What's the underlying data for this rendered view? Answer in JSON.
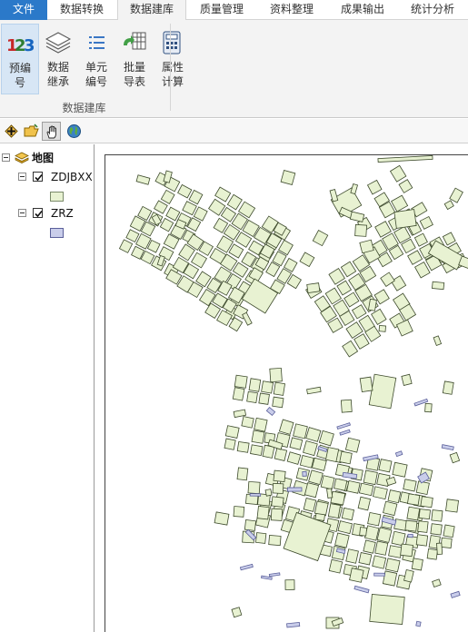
{
  "tabs": [
    {
      "label": "文件",
      "name": "tab-file"
    },
    {
      "label": "数据转换",
      "name": "tab-data-conversion"
    },
    {
      "label": "数据建库",
      "name": "tab-database-build"
    },
    {
      "label": "质量管理",
      "name": "tab-quality"
    },
    {
      "label": "资料整理",
      "name": "tab-materials"
    },
    {
      "label": "成果输出",
      "name": "tab-output"
    },
    {
      "label": "统计分析",
      "name": "tab-statistics"
    }
  ],
  "active_tab": "数据建库",
  "ribbon": {
    "group_label": "数据建库",
    "buttons": [
      {
        "label": "预编\n号",
        "icon": "pre-number-icon"
      },
      {
        "label": "数据\n继承",
        "icon": "layers-icon"
      },
      {
        "label": "单元\n编号",
        "icon": "list-icon"
      },
      {
        "label": "批量\n导表",
        "icon": "batch-table-icon"
      },
      {
        "label": "属性\n计算",
        "icon": "calculator-icon"
      }
    ]
  },
  "toolbar": {
    "tools": [
      "add-data-icon",
      "open-folder-icon",
      "pan-hand-icon",
      "globe-icon"
    ]
  },
  "toc": {
    "root_label": "地图",
    "layers": [
      {
        "name": "ZDJBXX",
        "checked": true,
        "fill": "#e8f2d2",
        "stroke": "#6f7f55"
      },
      {
        "name": "ZRZ",
        "checked": true,
        "fill": "#c9cdea",
        "stroke": "#5a5f9a"
      }
    ]
  },
  "colors": {
    "parcel_fill": "#e8f2d2",
    "parcel_stroke": "#3d4a2c",
    "building_fill": "#c9cdea",
    "building_stroke": "#5a5f9a",
    "file_tab": "#2b79c9"
  }
}
